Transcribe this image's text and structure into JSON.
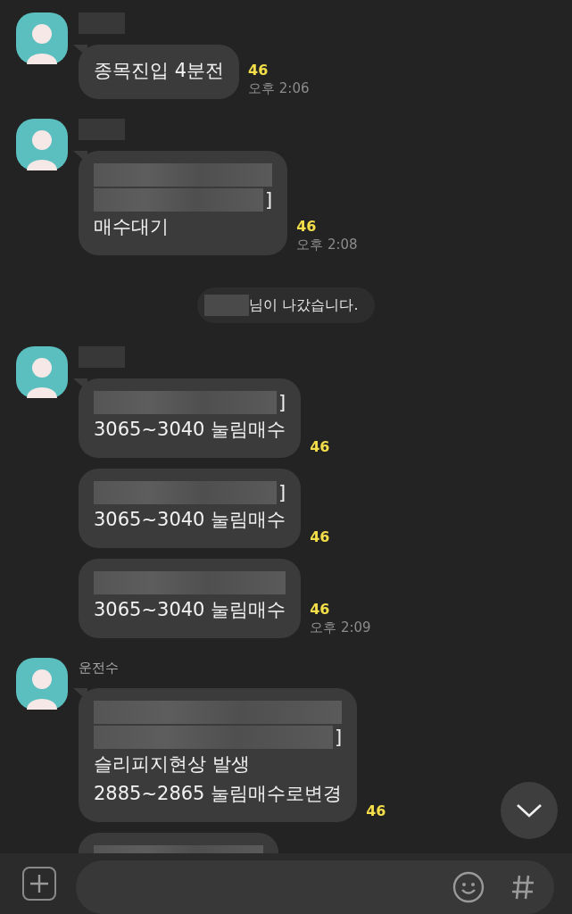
{
  "chat": [
    {
      "kind": "group",
      "sender": {
        "kind": "redacted"
      },
      "bubbles": [
        {
          "lines": [
            {
              "kind": "text",
              "text": "종목진입 4분전"
            }
          ],
          "unread": "46",
          "time": "오후 2:06"
        }
      ]
    },
    {
      "kind": "group",
      "sender": {
        "kind": "redacted"
      },
      "bubbles": [
        {
          "lines": [
            {
              "kind": "redacted"
            },
            {
              "kind": "redacted",
              "text": "]"
            },
            {
              "kind": "text",
              "text": "매수대기"
            }
          ],
          "unread": "46",
          "time": "오후 2:08"
        }
      ]
    },
    {
      "kind": "system",
      "text": "님이 나갔습니다."
    },
    {
      "kind": "group",
      "sender": {
        "kind": "redacted"
      },
      "bubbles": [
        {
          "lines": [
            {
              "kind": "redacted",
              "text": "]"
            },
            {
              "kind": "text",
              "text": "3065~3040 눌림매수"
            }
          ],
          "unread": "46"
        },
        {
          "lines": [
            {
              "kind": "redacted",
              "text": "]"
            },
            {
              "kind": "text",
              "text": "3065~3040 눌림매수"
            }
          ],
          "unread": "46"
        },
        {
          "lines": [
            {
              "kind": "redacted"
            },
            {
              "kind": "text",
              "text": "3065~3040 눌림매수"
            }
          ],
          "unread": "46",
          "time": "오후 2:09"
        }
      ]
    },
    {
      "kind": "group",
      "sender": {
        "kind": "text",
        "text": "운전수"
      },
      "bubbles": [
        {
          "lines": [
            {
              "kind": "redacted"
            },
            {
              "kind": "redacted",
              "text": "]"
            },
            {
              "kind": "text",
              "text": "슬리피지현상 발생"
            },
            {
              "kind": "text",
              "text": "2885~2865 눌림매수로변경"
            }
          ],
          "unread": "46"
        },
        {
          "lines": [
            {
              "kind": "redacted"
            }
          ]
        }
      ]
    }
  ]
}
